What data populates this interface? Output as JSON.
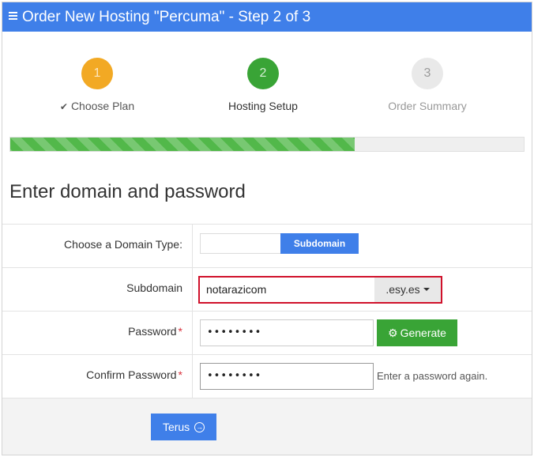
{
  "header": {
    "title": "Order New Hosting \"Percuma\" - Step 2 of 3"
  },
  "steps": [
    {
      "number": "1",
      "label": "Choose Plan",
      "state": "completed"
    },
    {
      "number": "2",
      "label": "Hosting Setup",
      "state": "active"
    },
    {
      "number": "3",
      "label": "Order Summary",
      "state": "pending"
    }
  ],
  "progress": {
    "fraction": 0.67
  },
  "section": {
    "title": "Enter domain and password"
  },
  "form": {
    "domain_type": {
      "label": "Choose a Domain Type:",
      "selected": "Subdomain"
    },
    "subdomain": {
      "label": "Subdomain",
      "value": "notarazicom",
      "suffix": ".esy.es"
    },
    "password": {
      "label": "Password",
      "required_mark": "*",
      "value": "••••••••",
      "generate_label": "Generate"
    },
    "confirm_password": {
      "label": "Confirm Password",
      "required_mark": "*",
      "value": "••••••••",
      "hint": "Enter a password again."
    }
  },
  "footer": {
    "submit_label": "Terus"
  },
  "colors": {
    "primary": "#3f7fe9",
    "success": "#39a436",
    "warning": "#f2a924",
    "danger": "#d0112b"
  }
}
